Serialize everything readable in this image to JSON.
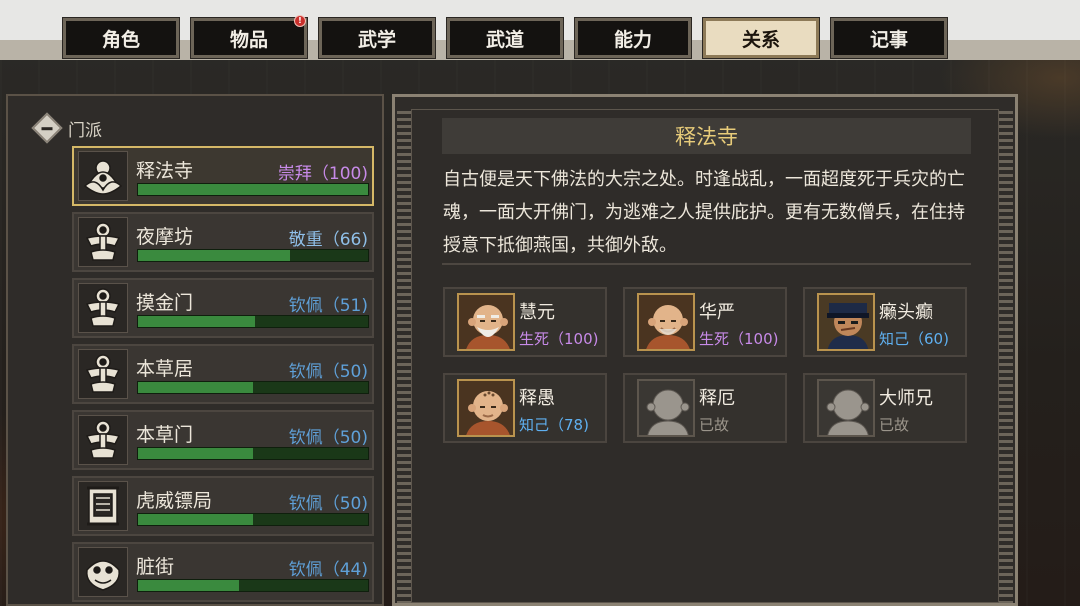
{
  "tabs": [
    {
      "label": "角色",
      "active": false,
      "badge": false
    },
    {
      "label": "物品",
      "active": false,
      "badge": true
    },
    {
      "label": "武学",
      "active": false,
      "badge": false
    },
    {
      "label": "武道",
      "active": false,
      "badge": false
    },
    {
      "label": "能力",
      "active": false,
      "badge": false
    },
    {
      "label": "关系",
      "active": true,
      "badge": false
    },
    {
      "label": "记事",
      "active": false,
      "badge": false
    }
  ],
  "notification_mark": "!",
  "sidebar": {
    "group_label": "门派",
    "group_icon": "collapse-minus-icon",
    "factions": [
      {
        "name": "释法寺",
        "status": "崇拜（100)",
        "status_color": "#c78ae8",
        "progress": 1.0,
        "emblem": "lotus-emblem-icon",
        "selected": true
      },
      {
        "name": "夜摩坊",
        "status": "敬重（66)",
        "status_color": "#8fbfe8",
        "progress": 0.66,
        "emblem": "ornament-emblem-icon",
        "selected": false
      },
      {
        "name": "摸金门",
        "status": "钦佩（51)",
        "status_color": "#5fa0d8",
        "progress": 0.51,
        "emblem": "ornament-emblem-icon",
        "selected": false
      },
      {
        "name": "本草居",
        "status": "钦佩（50)",
        "status_color": "#5fa0d8",
        "progress": 0.5,
        "emblem": "ornament-emblem-icon",
        "selected": false
      },
      {
        "name": "本草门",
        "status": "钦佩（50)",
        "status_color": "#5fa0d8",
        "progress": 0.5,
        "emblem": "ornament-emblem-icon",
        "selected": false
      },
      {
        "name": "虎威镖局",
        "status": "钦佩（50)",
        "status_color": "#5fa0d8",
        "progress": 0.5,
        "emblem": "tiger-banner-emblem-icon",
        "selected": false
      },
      {
        "name": "脏街",
        "status": "钦佩（44)",
        "status_color": "#5fa0d8",
        "progress": 0.44,
        "emblem": "lion-emblem-icon",
        "selected": false
      }
    ]
  },
  "detail": {
    "title": "释法寺",
    "description": "自古便是天下佛法的大宗之处。时逢战乱，一面超度死于兵灾的亡魂，一面大开佛门，为逃难之人提供庇护。更有无数僧兵，在住持授意下抵御燕国，共御外敌。",
    "members": [
      {
        "name": "慧元",
        "status": "生死（100)",
        "status_color": "#c78ae8",
        "alive": true,
        "portrait": "elder-monk-portrait-icon"
      },
      {
        "name": "华严",
        "status": "生死（100)",
        "status_color": "#c78ae8",
        "alive": true,
        "portrait": "bald-monk-portrait-icon"
      },
      {
        "name": "癞头癫",
        "status": "知己（60)",
        "status_color": "#5fb0f0",
        "alive": true,
        "portrait": "capped-man-portrait-icon"
      },
      {
        "name": "释愚",
        "status": "知己（78)",
        "status_color": "#5fb0f0",
        "alive": true,
        "portrait": "young-monk-portrait-icon"
      },
      {
        "name": "释厄",
        "status": "已故",
        "status_color": "#9b958b",
        "alive": false,
        "portrait": "deceased-monk-portrait-icon"
      },
      {
        "name": "大师兄",
        "status": "已故",
        "status_color": "#9b958b",
        "alive": false,
        "portrait": "deceased-monk-portrait-icon"
      }
    ]
  }
}
